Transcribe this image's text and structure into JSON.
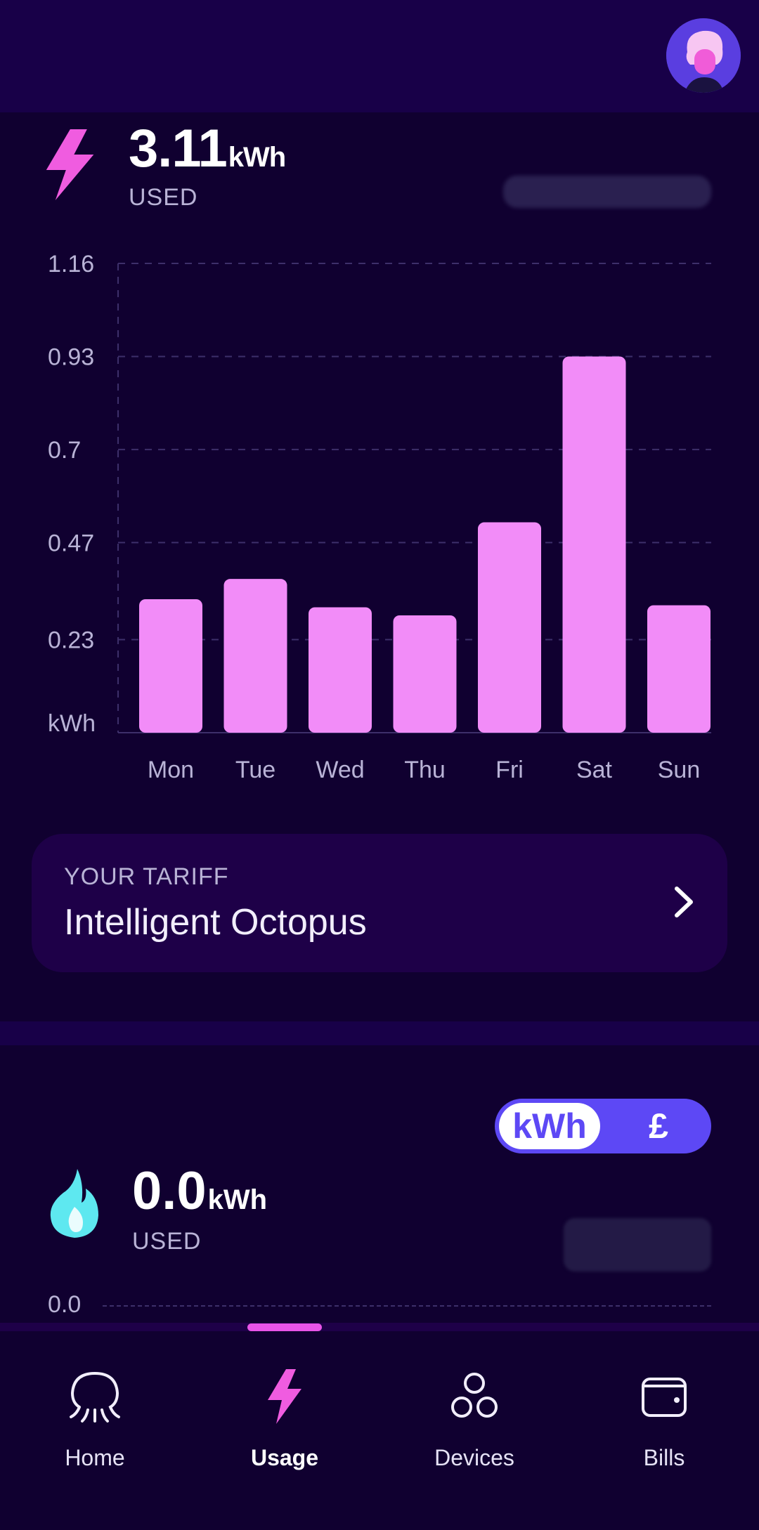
{
  "electricity": {
    "value": "3.11",
    "unit": "kWh",
    "label": "USED"
  },
  "chart_data": {
    "type": "bar",
    "categories": [
      "Mon",
      "Tue",
      "Wed",
      "Thu",
      "Fri",
      "Sat",
      "Sun"
    ],
    "values": [
      0.33,
      0.38,
      0.31,
      0.29,
      0.52,
      0.93,
      0.315
    ],
    "yticks": [
      "0.23",
      "0.47",
      "0.7",
      "0.93",
      "1.16"
    ],
    "ylabel": "kWh",
    "ylim": [
      0,
      1.16
    ],
    "grid": true,
    "color": "#f28cf8"
  },
  "tariff": {
    "label": "YOUR TARIFF",
    "name": "Intelligent Octopus"
  },
  "toggle": {
    "kwh": "kWh",
    "pound": "£"
  },
  "gas": {
    "value": "0.0",
    "unit": "kWh",
    "label": "USED",
    "axis_zero": "0.0"
  },
  "nav": {
    "items": [
      {
        "label": "Home",
        "icon": "octopus-icon"
      },
      {
        "label": "Usage",
        "icon": "bolt-icon"
      },
      {
        "label": "Devices",
        "icon": "devices-icon"
      },
      {
        "label": "Bills",
        "icon": "wallet-icon"
      }
    ],
    "active": "Usage"
  },
  "colors": {
    "background": "#100030",
    "accent_pink": "#f28cf8",
    "toggle_blue": "#5d48f5",
    "gas_cyan": "#5ee8f0"
  }
}
